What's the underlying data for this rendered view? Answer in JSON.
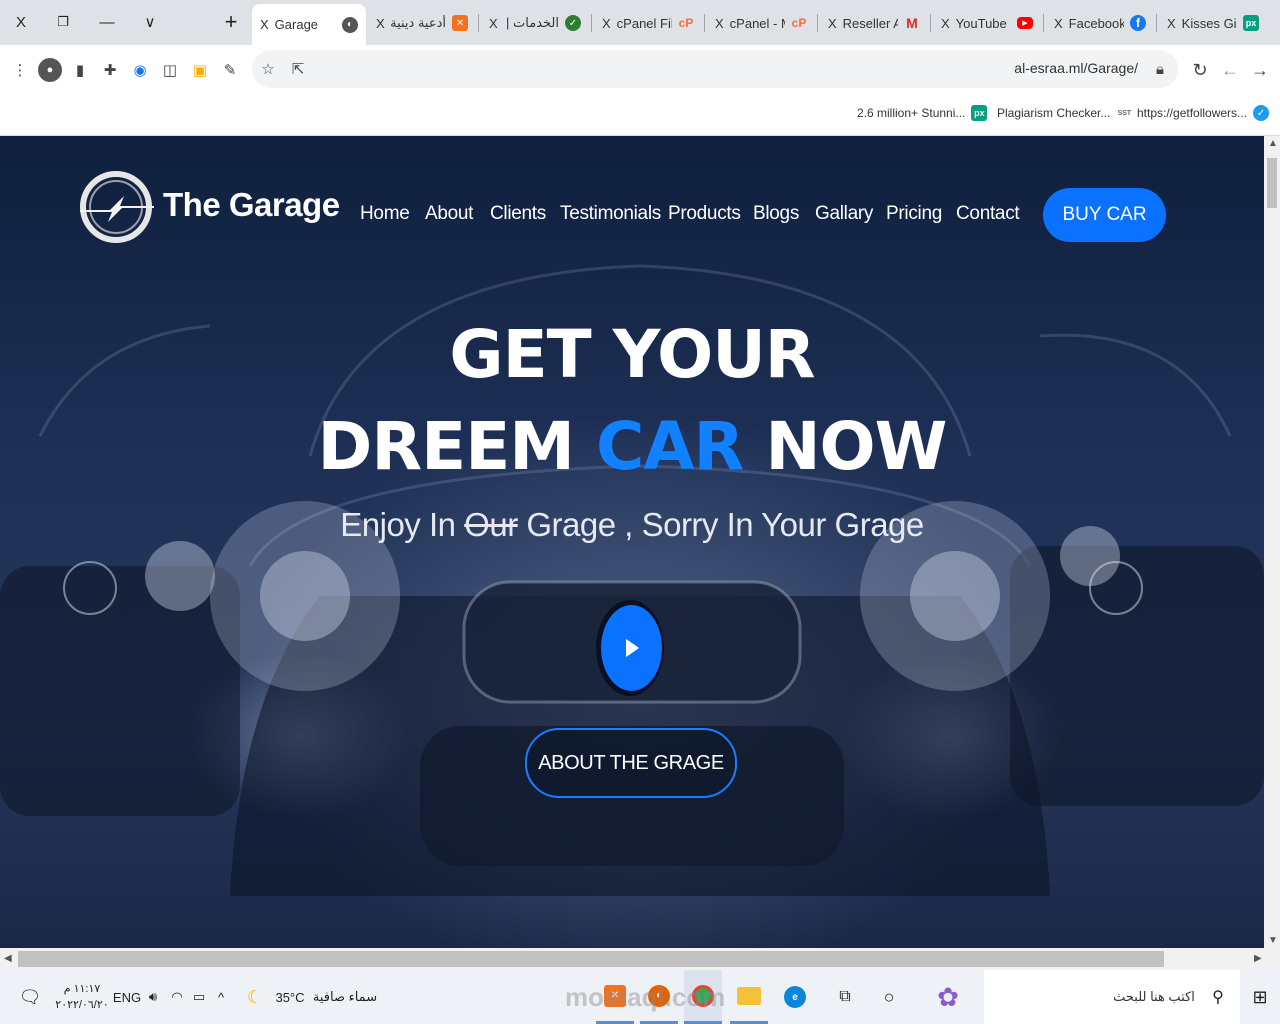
{
  "browser": {
    "window_controls": [
      "X",
      "❐",
      "—",
      "∨"
    ],
    "new_tab": "+",
    "tabs": [
      {
        "title": "Garage",
        "close": "X",
        "active": true
      },
      {
        "title": "أدعية دينية",
        "close": "X"
      },
      {
        "title": "الخدمات | S",
        "close": "X"
      },
      {
        "title": "cPanel File",
        "close": "X"
      },
      {
        "title": "cPanel - M",
        "close": "X"
      },
      {
        "title": "Reseller Ac",
        "close": "X"
      },
      {
        "title": "YouTube",
        "close": "X"
      },
      {
        "title": "Facebook",
        "close": "X"
      },
      {
        "title": "Kisses Girl",
        "close": "X"
      }
    ],
    "url": "al-esraa.ml/Garage/",
    "bookmarks": [
      {
        "label": "2.6 million+ Stunni..."
      },
      {
        "label": "Plagiarism Checker..."
      },
      {
        "label": "https://getfollowers..."
      }
    ]
  },
  "site": {
    "brand": "The Garage",
    "nav": [
      "Home",
      "About",
      "Clients",
      "Testimonials",
      "Products",
      "Blogs",
      "Gallary",
      "Pricing",
      "Contact"
    ],
    "cta": "BUY CAR",
    "headline_line1": "GET YOUR",
    "headline_line2_a": "DREEM",
    "headline_line2_b": "CAR",
    "headline_line2_c": "NOW",
    "sub_a": "Enjoy In",
    "sub_strike": "Our",
    "sub_b": "Grage , Sorry In Your Grage",
    "about_button": "ABOUT THE GRAGE",
    "accent_color": "#1281ff",
    "button_color": "#0a72ff"
  },
  "taskbar": {
    "search_placeholder": "اكتب هنا للبحث",
    "weather_temp": "35°C",
    "weather_text": "سماء صافية",
    "language": "ENG",
    "time": "١١:١٧ م",
    "date": "٢٠٢٢/٠٦/٢٠",
    "watermark": "mostaql.com"
  }
}
